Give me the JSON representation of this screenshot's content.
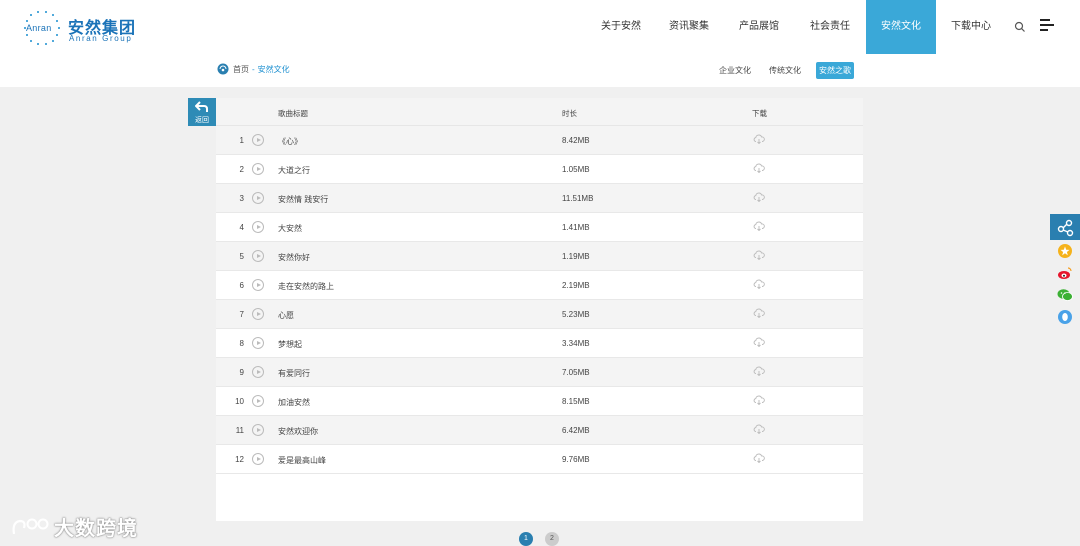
{
  "header": {
    "logo": {
      "badge": "Anran",
      "name_cn": "安然集团",
      "name_en": "Anran Group"
    },
    "nav": [
      {
        "label": "关于安然",
        "active": false
      },
      {
        "label": "资讯聚集",
        "active": false
      },
      {
        "label": "产品展馆",
        "active": false
      },
      {
        "label": "社会责任",
        "active": false
      },
      {
        "label": "安然文化",
        "active": true
      },
      {
        "label": "下载中心",
        "active": false
      }
    ],
    "search_icon": "search-icon",
    "menu_icon": "hamburger-menu-icon"
  },
  "breadcrumb": {
    "home": "首页",
    "separator": "-",
    "current": "安然文化"
  },
  "subtabs": [
    {
      "label": "企业文化",
      "active": false
    },
    {
      "label": "传统文化",
      "active": false
    },
    {
      "label": "安然之歌",
      "active": true
    }
  ],
  "back_button": {
    "label": "返回"
  },
  "table": {
    "headers": {
      "title": "歌曲标题",
      "duration": "时长",
      "download": "下载"
    },
    "rows": [
      {
        "num": "1",
        "title": "《心》",
        "size": "8.42MB"
      },
      {
        "num": "2",
        "title": "大道之行",
        "size": "1.05MB"
      },
      {
        "num": "3",
        "title": "安然情 践安行",
        "size": "11.51MB"
      },
      {
        "num": "4",
        "title": "大安然",
        "size": "1.41MB"
      },
      {
        "num": "5",
        "title": "安然你好",
        "size": "1.19MB"
      },
      {
        "num": "6",
        "title": "走在安然的路上",
        "size": "2.19MB"
      },
      {
        "num": "7",
        "title": "心愿",
        "size": "5.23MB"
      },
      {
        "num": "8",
        "title": "梦想起",
        "size": "3.34MB"
      },
      {
        "num": "9",
        "title": "有爱同行",
        "size": "7.05MB"
      },
      {
        "num": "10",
        "title": "加油安然",
        "size": "8.15MB"
      },
      {
        "num": "11",
        "title": "安然欢迎你",
        "size": "6.42MB"
      },
      {
        "num": "12",
        "title": "爱是最高山峰",
        "size": "9.76MB"
      }
    ]
  },
  "pagination": {
    "pages": [
      "1",
      "2"
    ],
    "current": "1"
  },
  "share_bar": {
    "items": [
      {
        "icon": "share-icon",
        "color": "#2a7fb0"
      },
      {
        "icon": "qzone-star-icon",
        "color": "#f5b21b"
      },
      {
        "icon": "weibo-icon",
        "color": "#e6162d"
      },
      {
        "icon": "wechat-icon",
        "color": "#3cb034"
      },
      {
        "icon": "qq-icon",
        "color": "#4aa2e8"
      }
    ]
  },
  "watermark": {
    "text": "大数跨境"
  },
  "colors": {
    "accent": "#3aa8d8",
    "brand": "#1b73b8",
    "page_bg": "#f0f0f0"
  }
}
